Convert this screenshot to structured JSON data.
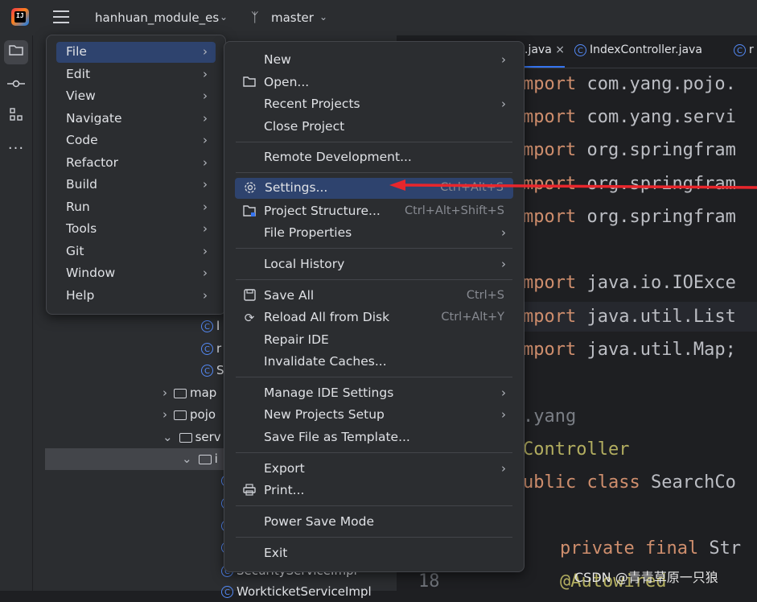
{
  "titlebar": {
    "project": "hanhuan_module_es",
    "branch": "master"
  },
  "tabs": [
    {
      "label": ".java"
    },
    {
      "label": "IndexController.java"
    },
    {
      "label": "r"
    }
  ],
  "tree": {
    "rows": [
      {
        "label": "l"
      },
      {
        "label": "r"
      },
      {
        "label": "S"
      },
      {
        "label": "map"
      },
      {
        "label": "pojo"
      },
      {
        "label": "serv"
      },
      {
        "label": "i"
      },
      {
        "label": "SecurityServiceImpl"
      },
      {
        "label": "WorkticketServiceImpl"
      }
    ]
  },
  "code": {
    "lines": [
      {
        "kw": "mport",
        "text": " com.yang.pojo."
      },
      {
        "kw": "mport",
        "text": " com.yang.servi"
      },
      {
        "kw": "mport",
        "text": " org.springfram"
      },
      {
        "kw": "mport",
        "text": " org.springfram"
      },
      {
        "kw": "mport",
        "text": " org.springfram"
      },
      {
        "kw": "mport",
        "text": " java.io.IOExce"
      },
      {
        "kw": "mport",
        "text": " java.util.List"
      },
      {
        "kw": "mport",
        "text": " java.util.Map;"
      },
      {
        "pkg": ".yang"
      },
      {
        "ann": "Controller"
      },
      {
        "kw": "ublic class",
        "text": " SearchCo"
      },
      {
        "kw": "private final",
        "text": " Str"
      },
      {
        "ann": "@Autowired"
      }
    ],
    "gutter_line": "18"
  },
  "main_menu": {
    "items": [
      {
        "label": "File"
      },
      {
        "label": "Edit"
      },
      {
        "label": "View"
      },
      {
        "label": "Navigate"
      },
      {
        "label": "Code"
      },
      {
        "label": "Refactor"
      },
      {
        "label": "Build"
      },
      {
        "label": "Run"
      },
      {
        "label": "Tools"
      },
      {
        "label": "Git"
      },
      {
        "label": "Window"
      },
      {
        "label": "Help"
      }
    ]
  },
  "file_menu": {
    "new": "New",
    "open": "Open...",
    "recent": "Recent Projects",
    "close": "Close Project",
    "remote": "Remote Development...",
    "settings": "Settings...",
    "settings_sc": "Ctrl+Alt+S",
    "structure": "Project Structure...",
    "structure_sc": "Ctrl+Alt+Shift+S",
    "file_props": "File Properties",
    "local_history": "Local History",
    "save_all": "Save All",
    "save_all_sc": "Ctrl+S",
    "reload": "Reload All from Disk",
    "reload_sc": "Ctrl+Alt+Y",
    "repair": "Repair IDE",
    "invalidate": "Invalidate Caches...",
    "manage": "Manage IDE Settings",
    "new_setup": "New Projects Setup",
    "save_template": "Save File as Template...",
    "export": "Export",
    "print": "Print...",
    "power_save": "Power Save Mode",
    "exit": "Exit"
  },
  "watermark": "CSDN @青青草原一只狼",
  "colors": {
    "selection": "#2e436e",
    "accent": "#3574f0",
    "arrow": "#e8262c"
  }
}
